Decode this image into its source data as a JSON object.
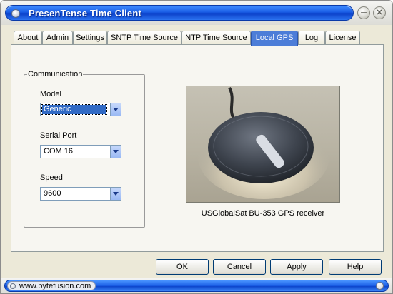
{
  "window": {
    "title": "PresenTense Time Client"
  },
  "tabs": [
    {
      "label": "About"
    },
    {
      "label": "Admin"
    },
    {
      "label": "Settings"
    },
    {
      "label": "SNTP Time Source"
    },
    {
      "label": "NTP Time Source"
    },
    {
      "label": "Local GPS",
      "active": true
    },
    {
      "label": "Log"
    },
    {
      "label": "License"
    }
  ],
  "communication": {
    "title": "Communication",
    "model": {
      "label": "Model",
      "value": "Generic"
    },
    "serial_port": {
      "label": "Serial Port",
      "value": "COM 16"
    },
    "speed": {
      "label": "Speed",
      "value": "9600"
    }
  },
  "device": {
    "caption": "USGlobalSat BU-353 GPS receiver"
  },
  "buttons": {
    "ok": "OK",
    "cancel": "Cancel",
    "apply_prefix": "",
    "apply_mnemonic": "A",
    "apply_rest": "pply",
    "help": "Help"
  },
  "status": {
    "url": "www.bytefusion.com"
  },
  "icons": {
    "minimize": "minimize-icon",
    "close": "close-icon",
    "dropdown": "chevron-down-icon"
  },
  "colors": {
    "accent": "#1b5fe6",
    "selection": "#316ac5",
    "active_tab": "#4c7dd8"
  }
}
